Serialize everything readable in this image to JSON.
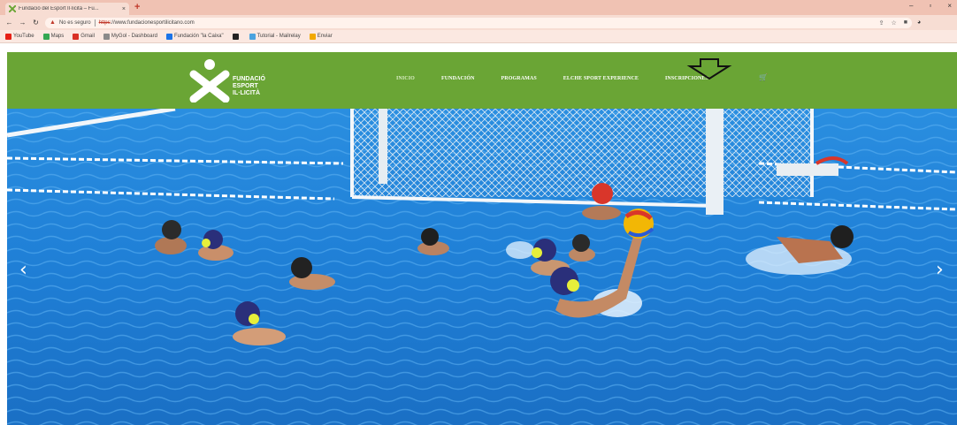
{
  "browser": {
    "tab_title": "Fundació del Esport Il·licità – Fu...",
    "tab_close": "×",
    "new_tab": "+",
    "win_minimize": "–",
    "win_restore": "▫",
    "win_close": "×",
    "insecure_label": "No es seguro",
    "url_https": "https",
    "url_rest": "://www.fundacionesportilicitano.com",
    "bookmarks": [
      {
        "label": "YouTube",
        "color": "#e62117"
      },
      {
        "label": "Maps",
        "color": "#34a853"
      },
      {
        "label": "Gmail",
        "color": "#d93025"
      },
      {
        "label": "MyGol - Dashboard",
        "color": "#8a8a8a"
      },
      {
        "label": "Fundación \"la Caixa\"",
        "color": "#1a73e8"
      },
      {
        "label": "",
        "color": "#222222"
      },
      {
        "label": "Tutorial - Mailrelay",
        "color": "#4aa3df"
      },
      {
        "label": "Enviar",
        "color": "#f2a900"
      }
    ]
  },
  "site": {
    "logo_line1": "FUNDACIÓ",
    "logo_line2": "ESPORT",
    "logo_line3": "IL·LICITÀ",
    "nav": [
      {
        "label": "INICIO"
      },
      {
        "label": "FUNDACIÓN"
      },
      {
        "label": "PROGRAMAS"
      },
      {
        "label": "ELCHE SPORT EXPERIENCE"
      },
      {
        "label": "INSCRIPCIONES"
      }
    ],
    "header_color": "#6aa535"
  },
  "hero": {
    "prev": "‹",
    "next": "›",
    "water_color": "#1f7fd6"
  }
}
